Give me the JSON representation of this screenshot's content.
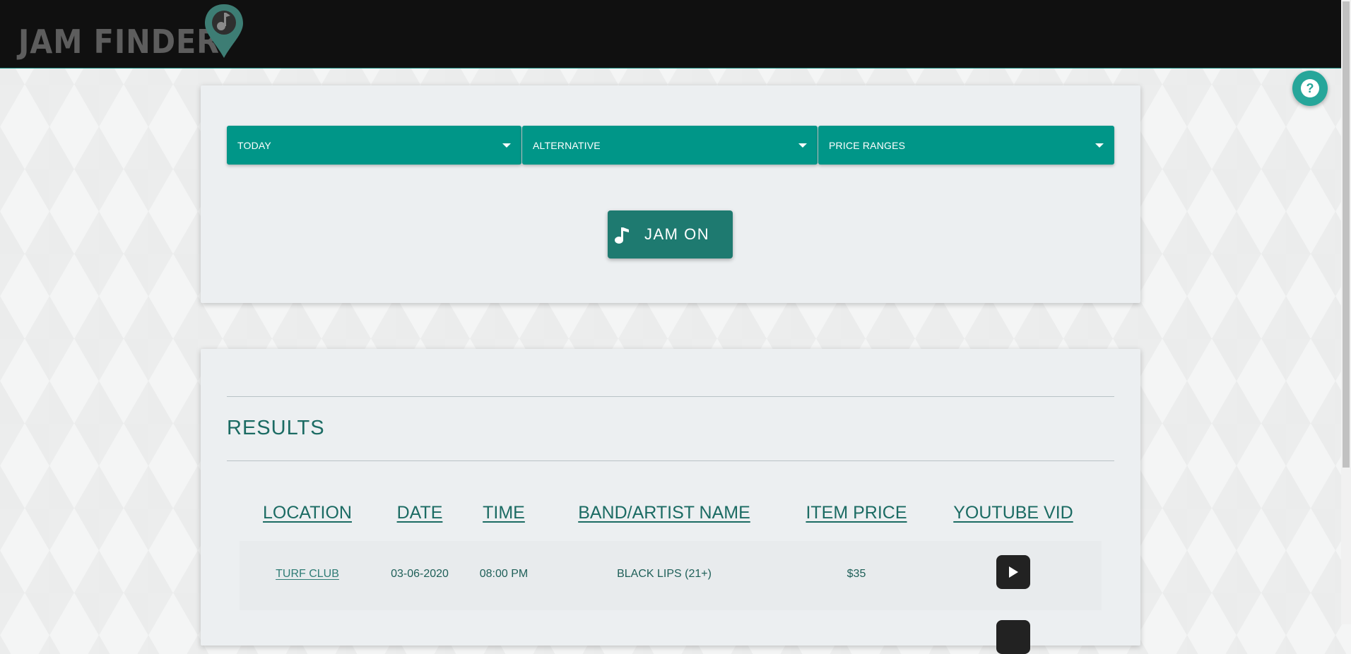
{
  "app": {
    "logo_text": "JAM FINDER"
  },
  "filters": {
    "date": {
      "value": "TODAY"
    },
    "genre": {
      "value": "ALTERNATIVE"
    },
    "price": {
      "value": "PRICE RANGES"
    }
  },
  "search": {
    "button_label": "JAM ON"
  },
  "results": {
    "title": "RESULTS",
    "columns": [
      "LOCATION",
      "DATE",
      "TIME",
      "BAND/ARTIST NAME",
      "ITEM PRICE",
      "YOUTUBE VID"
    ],
    "rows": [
      {
        "location": "TURF CLUB",
        "date": "03-06-2020",
        "time": "08:00 PM",
        "artist": "BLACK LIPS (21+)",
        "price": "$35"
      }
    ]
  },
  "icons": {
    "logo": "music-pin-icon",
    "help": "question-icon",
    "dropdown": "caret-down-icon",
    "jam_button": "music-note-icon",
    "youtube": "play-icon"
  },
  "colors": {
    "teal": "#009688",
    "dark_teal": "#1e7a70",
    "header_bg": "#101010",
    "text_teal": "#1b6b63"
  }
}
